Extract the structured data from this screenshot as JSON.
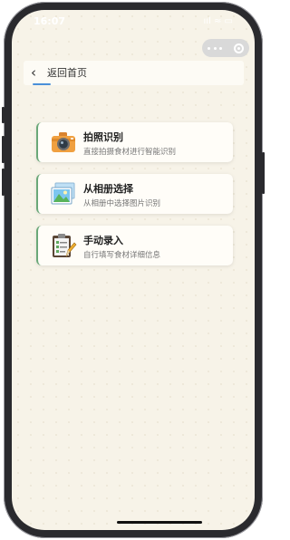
{
  "status_bar": {
    "time": "16:07",
    "indicators": "ııl ≈ ▭"
  },
  "capsule": {
    "menu_icon": "more-dots-icon",
    "close_icon": "target-icon"
  },
  "nav": {
    "back_icon": "chevron-left-icon",
    "title": "返回首页",
    "accent": "#4a90d9"
  },
  "options": [
    {
      "title": "拍照识别",
      "subtitle": "直接拍摄食材进行智能识别",
      "icon": "camera-icon"
    },
    {
      "title": "从相册选择",
      "subtitle": "从相册中选择图片识别",
      "icon": "photo-album-icon"
    },
    {
      "title": "手动录入",
      "subtitle": "自行填写食材详细信息",
      "icon": "clipboard-edit-icon"
    }
  ],
  "colors": {
    "background": "#f7f3e8",
    "card": "#fffdf8",
    "card_accent": "#6aa878"
  }
}
